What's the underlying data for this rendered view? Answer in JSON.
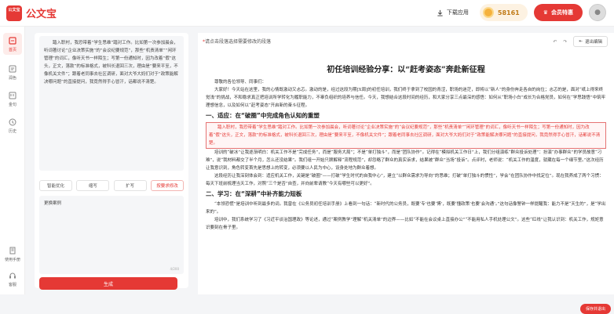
{
  "app": {
    "title": "公文宝",
    "logo_text": "公文宝"
  },
  "header": {
    "download_label": "下载应用",
    "coins": "58161",
    "vip_label": "会员特惠",
    "avatar_icon": "avatar"
  },
  "sidebar": {
    "items": [
      {
        "label": "首页",
        "icon": "home-icon"
      },
      {
        "label": "润色",
        "icon": "polish-icon"
      },
      {
        "label": "金句",
        "icon": "quote-icon"
      },
      {
        "label": "历史",
        "icon": "history-icon"
      },
      {
        "label": "使用手册",
        "icon": "manual-icon"
      },
      {
        "label": "客服",
        "icon": "support-icon"
      }
    ]
  },
  "left": {
    "source_text": "踏入职村，我恐带着“学生思维”踏对工作。比如第一次参加晨会，听词著讨论“企业决策实施”的“会议纪要规范”，那些“机责清单”“闲环管理”的词汇，像听天书一样陌生；写第一份通知时，因为改着“假”这头，正文，落款”的标准格式，被科长退回三次，理由是“要来平至，不像机关文件”；跟着老同事去社区调研，面对大爷大妈们对于“政策能解决哪问题”的直接提问，我竟然得手心冒汗，话都说不清楚。",
    "buttons": [
      "智能优化",
      "缩写",
      "扩写",
      "按要求修改"
    ],
    "request_text": "更换案例",
    "counter": "4/200",
    "generate_label": "生成"
  },
  "doc": {
    "hint": "请点击段落选择需要修改的段落",
    "exit_label": "退出编辑",
    "title": "初任培训经验分享：以“赶考姿态”奔赴新征程",
    "greeting": "尊敬的各位领导、同事们：",
    "p1": "大家好！今天站在这里，我的心情既激动又忐忑。激动的是，经过这段为期[X周]的初任培训，我们终于拿到了校园的青涩，职场的迷茫，即将以“新人”的身份奔走各自的岗位；忐忑的是，面对“纸上得来终觉浅”的挑战，不和稳求真正把培训所学转化为履职能力，不辜负组织的培养与信任。今天，我想结合这段时间的经历，和大家分享三点最深的感悟：如何从“职场小白”成长为合格党员，如何在“学思践悟”中筑牢理想信念，以及如何以“赶考姿态”开启新的奋斗征程。",
    "h1": "一、适应：在“破圈”中完成角色认知的重塑",
    "highlight": "踏入职村，我恐带着“学生思维”踏对工作。比如第一次参加晨会，听词著讨论“企业决策实施”的“会议纪要规范”，那些“机责清单”“闲环管理”的词汇，像听天书一样陌生；写第一份通知时，因为改着“假”这头，正文，落款”的标准格式，被科长退回三次，理由是“要来平至，不像机关文件”；跟着老同事去社区调研，面对大爷大妈们对于“政策能解决哪问题”的直接提问，我竟然得手心冒汗，话都说不清楚。",
    "p2": "培训的“破冰”让我逐渐明白：机关工作不是“完成任务”，而是“服务大局”；不是“单打独斗”，而是“团队协作”。记得在“模拟机关工作日”上，我们分组演练“群众投诉处理”：扮演“办事群众”的学员故意“刁难”，说“我材料都交了半个月，怎么还没结果”。我们组一开始只顾解释“流程规范”，却忽略了群众的真实诉求，结果被“群众”当场“投诉”。点评时，老师说：“机关工作的温度，就藏在每一个细节里。”这次经历让我意识到，角色转变首先是思想上的转变，必须要以人民为中心，设身处地为群众着想。",
    "p3": "这段经历让我深刻体会到：适应机关工作，关键是“破圈”——打破“学生时代的自我中心”，建立“以群众需求为导向”的思维；打破“单打独斗的惯性”，学会“在团队协作中找定位”。现在我养成了两个习惯：每天下班前梳理当天工作，对照“三个是否”自查，并向前辈请教“今天有哪些可以更好”。",
    "h2": "二、学习：在“深耕”中补齐能力短板",
    "p4": "“本领恐慌”是培训中听到最多的词。我曾在《公务员初任培训手册》上看到一句话：“新时代的公务员，既要‘专’也要‘博’，既要‘懂政策’也要‘会沟通’。”这句话像警钟一样提醒我：能力不是“天生的”，是“学出来的”。",
    "p5": "培训中，我们系统学习了《习近平谈治国理政》等论述，通过“案例教学”理解“机关清单”的边界——比如“不能在会议桌上直接办公”“不能用私人手机处理公文”。这些“红线”让我认识到：机关工作，规矩意识要刻在骨子里。",
    "float_label": "保存并退出"
  }
}
